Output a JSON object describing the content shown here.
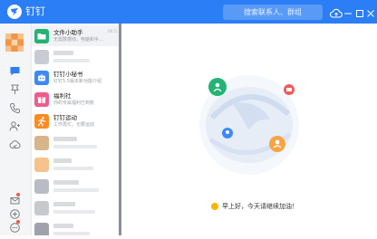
{
  "app": {
    "title": "钉钉",
    "brand_color": "#2b7ef5"
  },
  "header": {
    "search_placeholder": "搜索联系人、群组"
  },
  "conversations": [
    {
      "title": "文件小助手",
      "subtitle": "无需数据线，电脑和手…",
      "time": "06:5",
      "avatar_color": "#24b373",
      "icon": "folder-icon"
    },
    {
      "title": "钉钉小秘书",
      "subtitle": "钉钉5.5版本新功能介绍",
      "time": "",
      "avatar_color": "#3d8af7",
      "icon": "robot-icon"
    },
    {
      "title": "福利社",
      "subtitle": "你的专属福利已到账",
      "time": "",
      "avatar_color": "#ef5b8d",
      "icon": "gift-icon"
    },
    {
      "title": "钉钉运动",
      "subtitle": "工作再忙，也要运动",
      "time": "",
      "avatar_color": "#ff8a1f",
      "icon": "runner-icon"
    }
  ],
  "greeting": "早上好，今天请继续加油！"
}
